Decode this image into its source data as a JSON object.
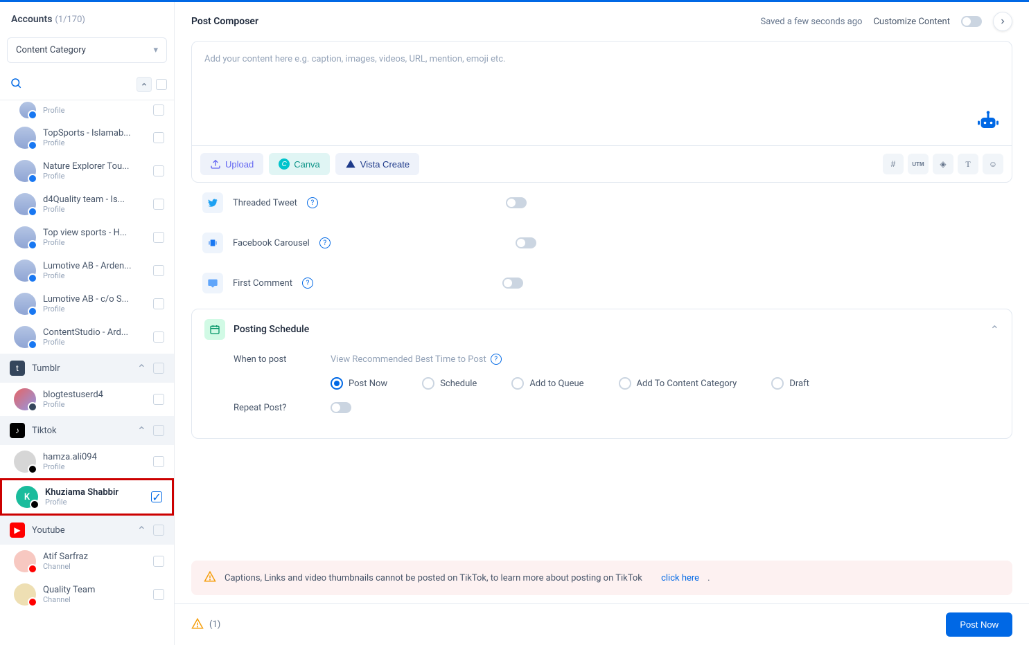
{
  "sidebar": {
    "title": "Accounts",
    "count": "(1/170)",
    "category_label": "Content Category",
    "fb_accounts": [
      {
        "name": "Profile",
        "type": ""
      },
      {
        "name": "TopSports - Islamab...",
        "type": "Profile"
      },
      {
        "name": "Nature Explorer Tou...",
        "type": "Profile"
      },
      {
        "name": "d4Quality team - Is...",
        "type": "Profile"
      },
      {
        "name": "Top view sports - H...",
        "type": "Profile"
      },
      {
        "name": "Lumotive AB - Arden...",
        "type": "Profile"
      },
      {
        "name": "Lumotive AB - c/o S...",
        "type": "Profile"
      },
      {
        "name": "ContentStudio - Ard...",
        "type": "Profile"
      }
    ],
    "groups": {
      "tumblr": {
        "label": "Tumblr",
        "items": [
          {
            "name": "blogtestuserd4",
            "type": "Profile"
          }
        ]
      },
      "tiktok": {
        "label": "Tiktok",
        "items": [
          {
            "name": "hamza.ali094",
            "type": "Profile",
            "selected": false
          },
          {
            "name": "Khuziama Shabbir",
            "type": "Profile",
            "selected": true
          }
        ]
      },
      "youtube": {
        "label": "Youtube",
        "items": [
          {
            "name": "Atif Sarfraz",
            "type": "Channel"
          },
          {
            "name": "Quality Team",
            "type": "Channel"
          }
        ]
      }
    }
  },
  "composer": {
    "title": "Post Composer",
    "saved_text": "Saved a few seconds ago",
    "customize_label": "Customize Content",
    "placeholder": "Add your content here e.g. caption, images, videos, URL, mention, emoji etc.",
    "toolbar": {
      "upload": "Upload",
      "canva": "Canva",
      "vista": "Vista Create"
    },
    "options": {
      "threaded": "Threaded Tweet",
      "carousel": "Facebook Carousel",
      "first_comment": "First Comment"
    },
    "schedule": {
      "title": "Posting Schedule",
      "when_label": "When to post",
      "best_time": "View Recommended Best Time to Post",
      "radios": [
        "Post Now",
        "Schedule",
        "Add to Queue",
        "Add To Content Category",
        "Draft"
      ],
      "repeat_label": "Repeat Post?"
    }
  },
  "warning": {
    "text": "Captions, Links and video thumbnails cannot be posted on TikTok, to learn more about posting on TikTok",
    "link": "click here"
  },
  "footer": {
    "warn_count": "(1)",
    "post_btn": "Post Now"
  }
}
